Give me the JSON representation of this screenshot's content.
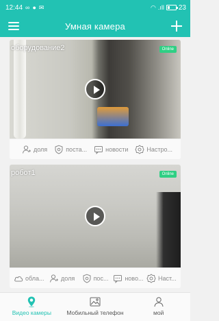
{
  "status_bar": {
    "time": "12:44",
    "signal_text": ".ıll",
    "battery": "23"
  },
  "header": {
    "title": "Умная камера"
  },
  "cameras": [
    {
      "name": "оборудование2",
      "status": "Online",
      "actions": [
        {
          "label": "доля",
          "icon": "share-user-icon"
        },
        {
          "label": "поста...",
          "icon": "shield-icon"
        },
        {
          "label": "новости",
          "icon": "message-icon"
        },
        {
          "label": "Настро...",
          "icon": "settings-gear-icon"
        }
      ]
    },
    {
      "name": "робот1",
      "status": "Online",
      "actions": [
        {
          "label": "обла...",
          "icon": "cloud-icon"
        },
        {
          "label": "доля",
          "icon": "share-user-icon"
        },
        {
          "label": "пос...",
          "icon": "shield-icon"
        },
        {
          "label": "ново...",
          "icon": "message-icon"
        },
        {
          "label": "Наст...",
          "icon": "settings-gear-icon"
        }
      ]
    }
  ],
  "bottom_nav": {
    "items": [
      {
        "label": "Видео камеры",
        "icon": "location-pin-icon",
        "active": true
      },
      {
        "label": "Мобильный телефон",
        "icon": "image-icon",
        "active": false
      },
      {
        "label": "мой",
        "icon": "person-icon",
        "active": false
      }
    ]
  },
  "colors": {
    "accent": "#22c2b3",
    "online": "#2fcf84"
  }
}
